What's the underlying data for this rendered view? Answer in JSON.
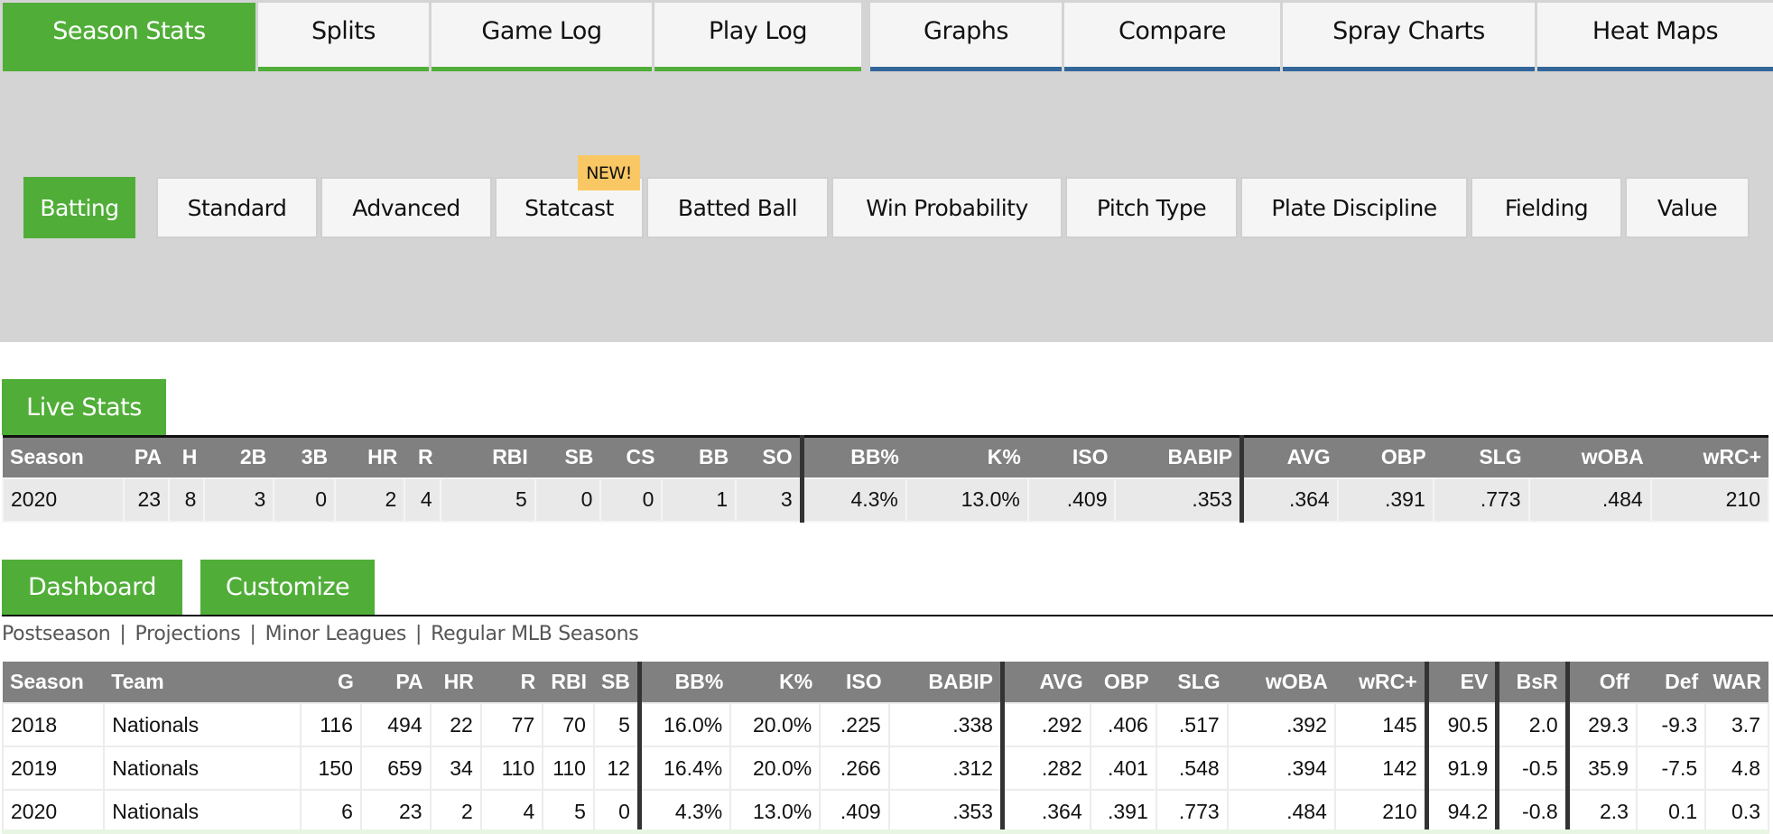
{
  "top_tabs": [
    {
      "label": "Season Stats",
      "active": true,
      "group": "green"
    },
    {
      "label": "Splits",
      "group": "green"
    },
    {
      "label": "Game Log",
      "group": "green"
    },
    {
      "label": "Play Log",
      "group": "green"
    },
    {
      "label": "Graphs",
      "group": "blue"
    },
    {
      "label": "Compare",
      "group": "blue"
    },
    {
      "label": "Spray Charts",
      "group": "blue"
    },
    {
      "label": "Heat Maps",
      "group": "blue"
    }
  ],
  "sub_tabs": [
    {
      "label": "Batting",
      "active": true
    },
    {
      "label": "Standard"
    },
    {
      "label": "Advanced"
    },
    {
      "label": "Statcast",
      "badge": "NEW!"
    },
    {
      "label": "Batted Ball"
    },
    {
      "label": "Win Probability"
    },
    {
      "label": "Pitch Type"
    },
    {
      "label": "Plate Discipline"
    },
    {
      "label": "Fielding"
    },
    {
      "label": "Value"
    }
  ],
  "live_stats": {
    "button_label": "Live Stats",
    "headers": [
      "Season",
      "PA",
      "H",
      "2B",
      "3B",
      "HR",
      "R",
      "RBI",
      "SB",
      "CS",
      "BB",
      "SO",
      "BB%",
      "K%",
      "ISO",
      "BABIP",
      "AVG",
      "OBP",
      "SLG",
      "wOBA",
      "wRC+"
    ],
    "rows": [
      [
        "2020",
        "23",
        "8",
        "3",
        "0",
        "2",
        "4",
        "5",
        "0",
        "0",
        "1",
        "3",
        "4.3%",
        "13.0%",
        ".409",
        ".353",
        ".364",
        ".391",
        ".773",
        ".484",
        "210"
      ]
    ]
  },
  "dashboard": {
    "dashboard_label": "Dashboard",
    "customize_label": "Customize",
    "links": [
      "Postseason",
      "Projections",
      "Minor Leagues",
      "Regular MLB Seasons"
    ],
    "headers": [
      "Season",
      "Team",
      "G",
      "PA",
      "HR",
      "R",
      "RBI",
      "SB",
      "BB%",
      "K%",
      "ISO",
      "BABIP",
      "AVG",
      "OBP",
      "SLG",
      "wOBA",
      "wRC+",
      "EV",
      "BsR",
      "Off",
      "Def",
      "WAR"
    ],
    "rows": [
      [
        "2018",
        "Nationals",
        "116",
        "494",
        "22",
        "77",
        "70",
        "5",
        "16.0%",
        "20.0%",
        ".225",
        ".338",
        ".292",
        ".406",
        ".517",
        ".392",
        "145",
        "90.5",
        "2.0",
        "29.3",
        "-9.3",
        "3.7"
      ],
      [
        "2019",
        "Nationals",
        "150",
        "659",
        "34",
        "110",
        "110",
        "12",
        "16.4%",
        "20.0%",
        ".266",
        ".312",
        ".282",
        ".401",
        ".548",
        ".394",
        "142",
        "91.9",
        "-0.5",
        "35.9",
        "-7.5",
        "4.8"
      ],
      [
        "2020",
        "Nationals",
        "6",
        "23",
        "2",
        "4",
        "5",
        "0",
        "4.3%",
        "13.0%",
        ".409",
        ".353",
        ".364",
        ".391",
        ".773",
        ".484",
        "210",
        "94.2",
        "-0.8",
        "2.3",
        "0.1",
        "0.3"
      ]
    ]
  },
  "colors": {
    "accent_green": "#50ae38",
    "accent_blue": "#336699",
    "badge": "#f9c864",
    "header_gray": "#808080"
  }
}
